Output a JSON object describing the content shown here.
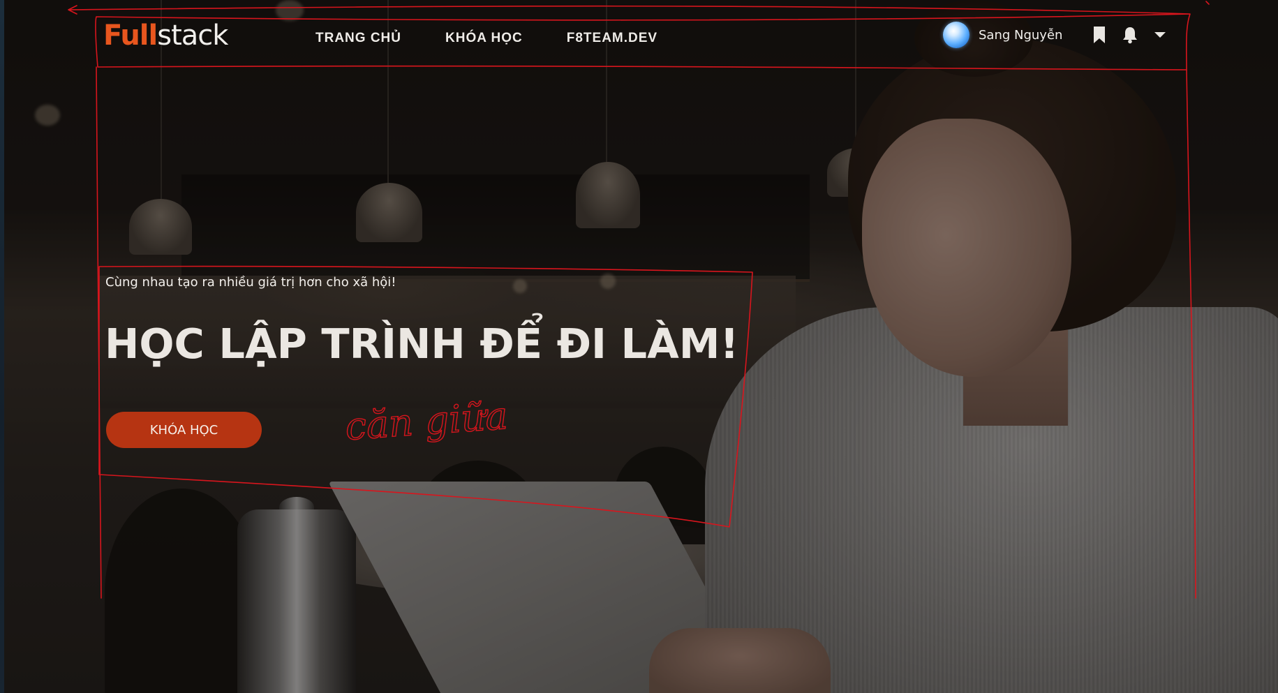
{
  "header": {
    "logo_part1": "Full",
    "logo_part2": "stack",
    "nav": [
      {
        "label": "TRANG CHỦ"
      },
      {
        "label": "KHÓA HỌC"
      },
      {
        "label": "F8TEAM.DEV"
      }
    ],
    "user_name": "Sang Nguyễn",
    "icons": {
      "bookmark": "bookmark-icon",
      "bell": "bell-icon",
      "dropdown": "chevron-down-icon"
    }
  },
  "hero": {
    "subtitle": "Cùng nhau tạo ra nhiều giá trị hơn cho xã hội!",
    "title": "HỌC LẬP TRÌNH ĐỂ ĐI LÀM!",
    "button_label": "KHÓA HỌC"
  },
  "annotations": {
    "handwritten_note": "căn giữa"
  },
  "colors": {
    "accent": "#e8561e",
    "button": "#b63412",
    "annotation": "#d8151d"
  }
}
